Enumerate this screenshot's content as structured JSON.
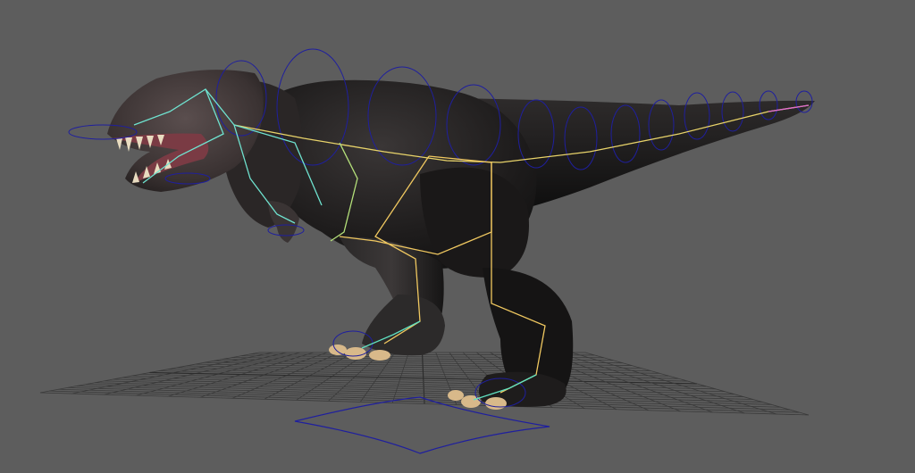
{
  "viewport": {
    "background": "#5d5d5d",
    "grid_color": "#3a3a3a",
    "grid_center_color": "#2c2c2c",
    "skin_dark": "#141414",
    "skin_mid": "#242323",
    "skin_head": "#4a4040",
    "claw_color": "#d8b98a",
    "teeth_color": "#e8dcc0",
    "mouth_color": "#7a3b44",
    "ik_controls_color": "#1f1f9e",
    "joint_colors": {
      "spine": "#e8d36a",
      "tail": "#b4e07a",
      "head": "#6fe3d0",
      "legs": "#f0c860",
      "feet": "#5fe0c0",
      "tail_tip": "#e06ad0"
    }
  },
  "icons": {
    "model": "t-rex-model-icon",
    "skeleton": "skeleton-joints-icon",
    "controls": "ik-control-curves-icon",
    "grid": "ground-grid-icon"
  }
}
